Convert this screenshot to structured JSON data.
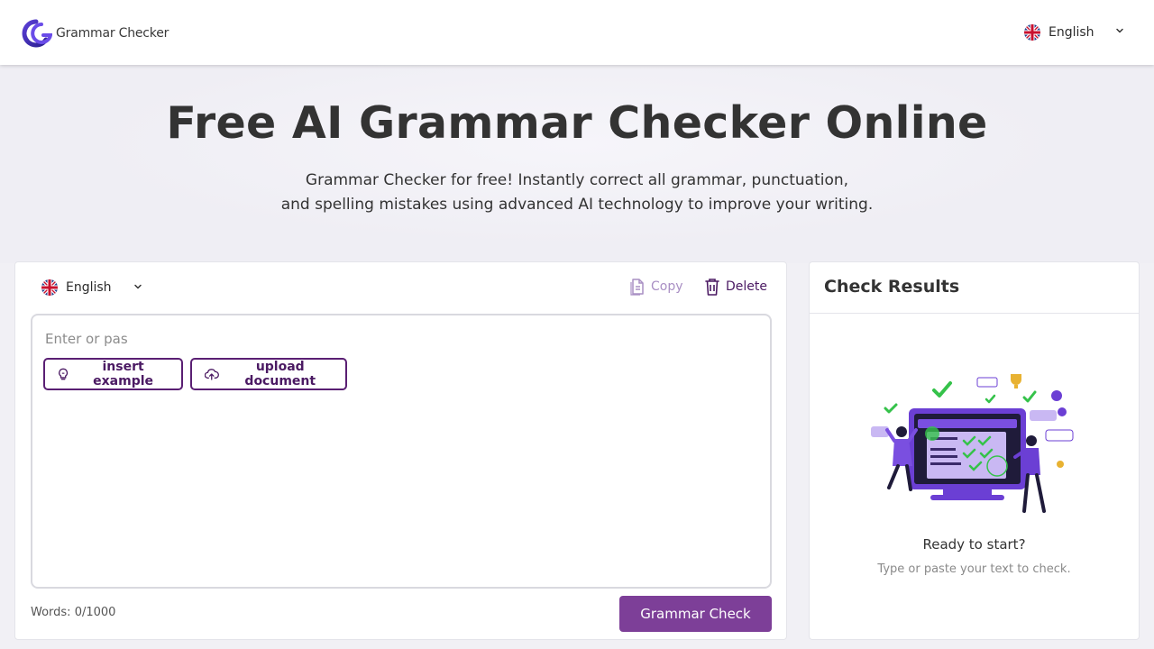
{
  "header": {
    "logo_text": "Grammar Checker",
    "language": "English"
  },
  "hero": {
    "title": "Free AI Grammar Checker Online",
    "subtitle_line1": "Grammar Checker for free! Instantly correct all grammar, punctuation,",
    "subtitle_line2": "and spelling mistakes using advanced AI technology to improve your writing."
  },
  "editor": {
    "language": "English",
    "copy_label": "Copy",
    "delete_label": "Delete",
    "placeholder": "Enter or pas",
    "value": "",
    "insert_example_label": "insert example",
    "upload_document_label": "upload document",
    "word_count": "Words: 0/1000",
    "check_button_label": "Grammar Check"
  },
  "results": {
    "title": "Check Results",
    "ready_text": "Ready to start?",
    "hint_text": "Type or paste your text to check."
  },
  "icons": {
    "logo": "grammar-checker-logo",
    "language_flag": "uk-flag-icon",
    "dropdown": "chevron-down-icon",
    "copy": "copy-icon",
    "delete": "trash-icon",
    "insert_example": "lightbulb-icon",
    "upload_document": "cloud-upload-icon"
  },
  "colors": {
    "brand_purple": "#7d3f98",
    "dark_purple": "#4b1a63",
    "copy_disabled": "#a98fc4",
    "background": "#f1f0f5"
  }
}
